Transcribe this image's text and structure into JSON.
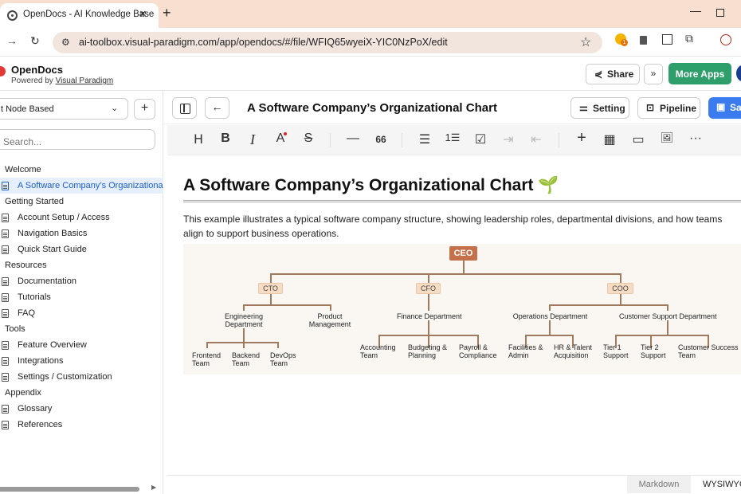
{
  "browser": {
    "tab_title": "OpenDocs - AI Knowledge Base",
    "url": "ai-toolbox.visual-paradigm.com/app/opendocs/#/file/WFIQ65wyeiX-YIC0NzPoX/edit",
    "extension_badge": "1"
  },
  "app": {
    "name": "OpenDocs",
    "powered_prefix": "Powered by ",
    "powered_link": "Visual Paradigm",
    "share_label": "Share",
    "more_apps_label": "More Apps"
  },
  "sidebar": {
    "mode": "t Node Based",
    "search_placeholder": "Search...",
    "items": [
      {
        "type": "section",
        "label": "Welcome"
      },
      {
        "type": "page",
        "label": "A Software Company’s Organizational Chart",
        "active": true
      },
      {
        "type": "section",
        "label": "Getting Started"
      },
      {
        "type": "page",
        "label": "Account Setup / Access"
      },
      {
        "type": "page",
        "label": "Navigation Basics"
      },
      {
        "type": "page",
        "label": "Quick Start Guide"
      },
      {
        "type": "section",
        "label": "Resources"
      },
      {
        "type": "page",
        "label": "Documentation"
      },
      {
        "type": "page",
        "label": "Tutorials"
      },
      {
        "type": "page",
        "label": "FAQ"
      },
      {
        "type": "section",
        "label": "Tools"
      },
      {
        "type": "page",
        "label": "Feature Overview"
      },
      {
        "type": "page",
        "label": "Integrations"
      },
      {
        "type": "page",
        "label": "Settings / Customization"
      },
      {
        "type": "section",
        "label": "Appendix"
      },
      {
        "type": "page",
        "label": "Glossary"
      },
      {
        "type": "page",
        "label": "References"
      }
    ]
  },
  "docbar": {
    "title": "A Software Company’s Organizational Chart",
    "setting_label": "Setting",
    "pipeline_label": "Pipeline",
    "save_label": "Sav"
  },
  "toolbar": {
    "heading": "H",
    "bold": "B",
    "italic": "I",
    "font_color": "A",
    "strike": "S",
    "hr": "—",
    "quote": "66",
    "bullets": "☰",
    "numbered": "1☰",
    "task": "☑",
    "indent": "⇥",
    "outdent": "⇤",
    "insert": "+",
    "table": "▦",
    "container": "▭",
    "image": "🖼",
    "more": "···"
  },
  "document": {
    "heading": "A Software Company’s Organizational Chart",
    "heading_emoji": "🌱",
    "intro": "This example illustrates a typical software company structure, showing leadership roles, departmental divisions, and how teams align to support business operations."
  },
  "org_chart": {
    "ceo": "CEO",
    "cto": "CTO",
    "cfo": "CFO",
    "coo": "COO",
    "engineering": "Engineering\nDepartment",
    "product": "Product\nManagement",
    "finance": "Finance Department",
    "operations": "Operations Department",
    "support": "Customer Support Department",
    "frontend": "Frontend\nTeam",
    "backend": "Backend\nTeam",
    "devops": "DevOps\nTeam",
    "accounting": "Accounting\nTeam",
    "budgeting": "Budgeting &\nPlanning",
    "payroll": "Payroll &\nCompliance",
    "facilities": "Facilities &\nAdmin",
    "hr": "HR & Talent\nAcquisition",
    "tier1": "Tier 1\nSupport",
    "tier2": "Tier 2\nSupport",
    "success": "Customer Success\nTeam"
  },
  "footer": {
    "markdown": "Markdown",
    "wysiwyg": "WYSIWYG"
  }
}
